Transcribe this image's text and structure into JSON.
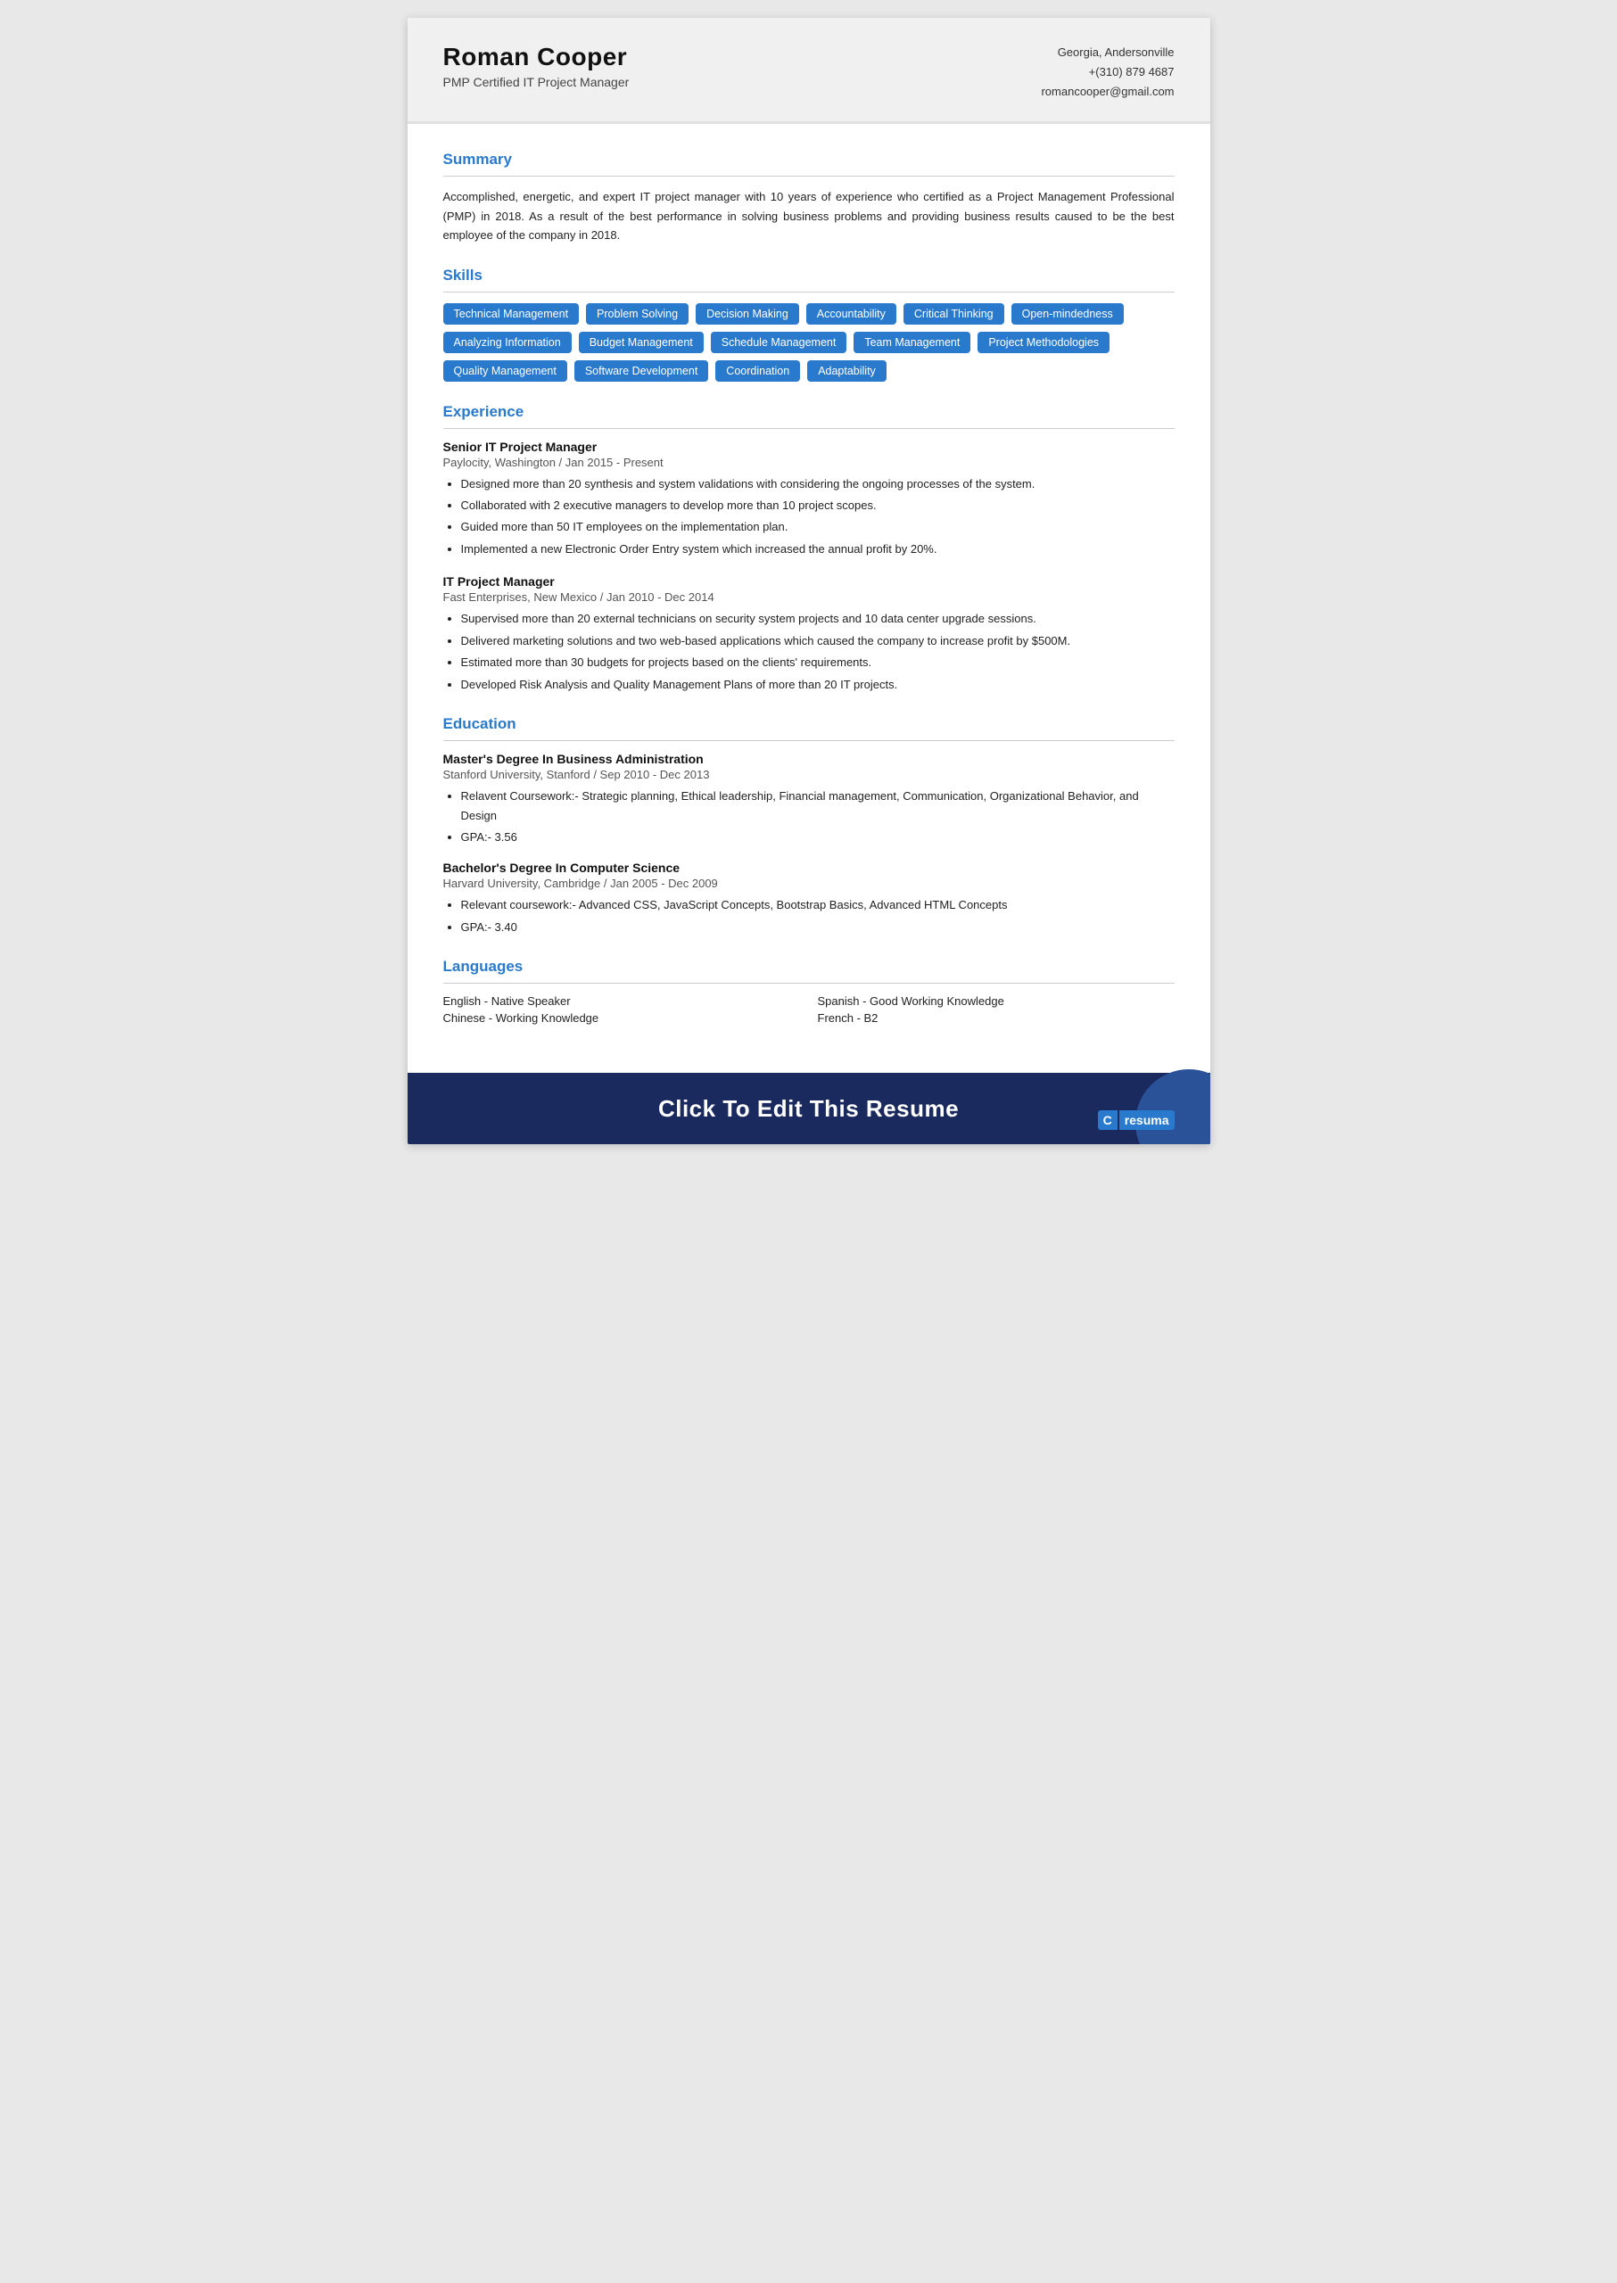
{
  "header": {
    "name": "Roman Cooper",
    "title": "PMP Certified IT Project Manager",
    "location": "Georgia, Andersonville",
    "phone": "+(310) 879 4687",
    "email": "romancooper@gmail.com"
  },
  "sections": {
    "summary": {
      "label": "Summary",
      "text": "Accomplished, energetic, and expert IT project manager with 10 years of experience who certified as a Project Management Professional (PMP) in 2018. As a result of the best performance in solving business problems and providing business results caused to be the best employee of the company in 2018."
    },
    "skills": {
      "label": "Skills",
      "items": [
        "Technical Management",
        "Problem Solving",
        "Decision Making",
        "Accountability",
        "Critical Thinking",
        "Open-mindedness",
        "Analyzing Information",
        "Budget Management",
        "Schedule Management",
        "Team Management",
        "Project Methodologies",
        "Quality Management",
        "Software Development",
        "Coordination",
        "Adaptability"
      ]
    },
    "experience": {
      "label": "Experience",
      "jobs": [
        {
          "title": "Senior IT Project Manager",
          "meta": "Paylocity, Washington / Jan 2015 - Present",
          "bullets": [
            "Designed more than 20 synthesis and system validations with considering the ongoing processes of the system.",
            "Collaborated with 2 executive managers to develop more than 10 project scopes.",
            "Guided more than 50 IT employees on the implementation plan.",
            "Implemented a new Electronic Order Entry system which increased the annual profit by 20%."
          ]
        },
        {
          "title": "IT Project Manager",
          "meta": "Fast Enterprises, New Mexico / Jan 2010 - Dec 2014",
          "bullets": [
            "Supervised more than 20 external technicians on security system projects and 10 data center upgrade sessions.",
            "Delivered marketing solutions and two web-based applications which caused the company to increase profit by $500M.",
            "Estimated more than 30 budgets for projects based on the clients' requirements.",
            "Developed Risk Analysis and Quality Management Plans of more than 20 IT projects."
          ]
        }
      ]
    },
    "education": {
      "label": "Education",
      "items": [
        {
          "degree": "Master's Degree In Business Administration",
          "meta": "Stanford University, Stanford / Sep 2010 - Dec 2013",
          "bullets": [
            "Relavent Coursework:- Strategic planning, Ethical leadership, Financial management, Communication, Organizational Behavior, and Design",
            "GPA:- 3.56"
          ]
        },
        {
          "degree": "Bachelor's Degree In Computer Science",
          "meta": "Harvard University, Cambridge / Jan 2005 - Dec 2009",
          "bullets": [
            "Relevant coursework:- Advanced CSS, JavaScript Concepts,  Bootstrap Basics, Advanced HTML Concepts",
            "GPA:- 3.40"
          ]
        }
      ]
    },
    "languages": {
      "label": "Languages",
      "items": [
        {
          "lang": "English - Native Speaker",
          "col": 1
        },
        {
          "lang": "Spanish - Good Working Knowledge",
          "col": 2
        },
        {
          "lang": "Chinese - Working Knowledge",
          "col": 1
        },
        {
          "lang": "French - B2",
          "col": 2
        }
      ]
    }
  },
  "footer": {
    "cta_text": "Click To Edit This Resume",
    "logo_icon": "C",
    "logo_text": "resuma"
  }
}
